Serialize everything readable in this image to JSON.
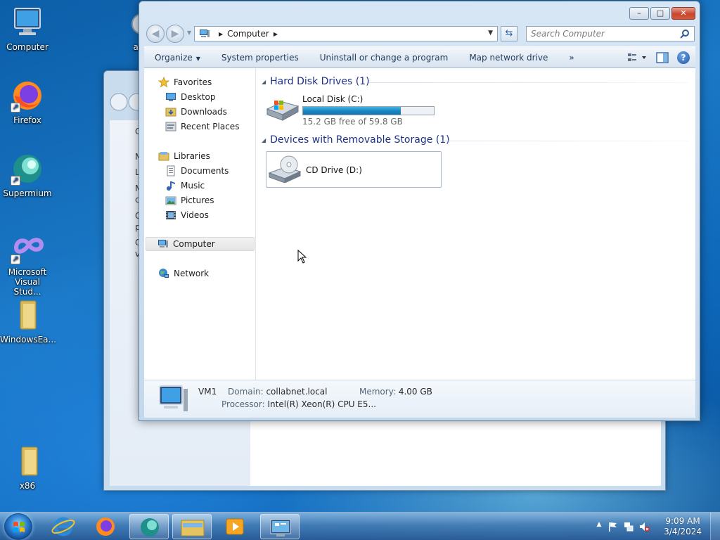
{
  "desktop": {
    "icons": [
      {
        "label": "Computer"
      },
      {
        "label": "auto"
      },
      {
        "label": "Firefox"
      },
      {
        "label": "Supermium"
      },
      {
        "label": "Microsoft Visual Stud..."
      },
      {
        "label": "WindowsEa..."
      },
      {
        "label": "x86"
      }
    ]
  },
  "background_window": {
    "lines": [
      "Co",
      "Ma",
      "Lin",
      "Ma",
      "ce",
      "Co",
      "pro",
      "Ch",
      "va"
    ]
  },
  "explorer": {
    "caption": {
      "minimize": "–",
      "maximize": "□",
      "close": "✕"
    },
    "address": {
      "crumb": "Computer"
    },
    "search": {
      "placeholder": "Search Computer"
    },
    "toolbar": {
      "organize": "Organize",
      "system_properties": "System properties",
      "uninstall": "Uninstall or change a program",
      "map_drive": "Map network drive",
      "more": "»"
    },
    "nav": {
      "favorites": "Favorites",
      "desktop": "Desktop",
      "downloads": "Downloads",
      "recent": "Recent Places",
      "libraries": "Libraries",
      "documents": "Documents",
      "music": "Music",
      "pictures": "Pictures",
      "videos": "Videos",
      "computer": "Computer",
      "network": "Network"
    },
    "groups": {
      "hard_disks": "Hard Disk Drives (1)",
      "removable": "Devices with Removable Storage (1)"
    },
    "drives": {
      "local": {
        "name": "Local Disk (C:)",
        "free_text": "15.2 GB free of 59.8 GB",
        "used_fraction": 0.746
      },
      "cd": {
        "name": "CD Drive (D:)"
      }
    },
    "details": {
      "name": "VM1",
      "domain_label": "Domain:",
      "domain": "collabnet.local",
      "memory_label": "Memory:",
      "memory": "4.00 GB",
      "processor_label": "Processor:",
      "processor": "Intel(R) Xeon(R) CPU E5..."
    }
  },
  "taskbar": {
    "time": "9:09 AM",
    "date": "3/4/2024",
    "tray_expand": "▲"
  },
  "colors": {
    "group_header": "#1e3287",
    "drive_bar": "#1a86c5",
    "desktop": "#1a78c6"
  }
}
